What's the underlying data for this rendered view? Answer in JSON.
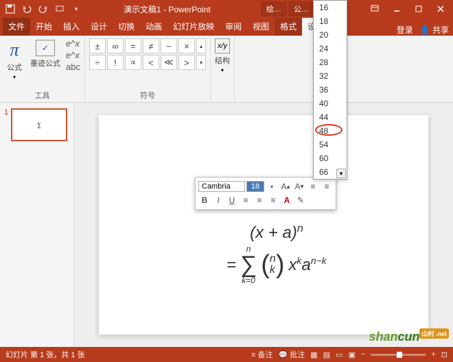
{
  "app": {
    "title": "演示文稿1 - PowerPoint"
  },
  "context_tabs": [
    "绘…",
    "公…"
  ],
  "menu": {
    "file": "文件",
    "home": "开始",
    "insert": "插入",
    "design": "设计",
    "transition": "切换",
    "animation": "动画",
    "slideshow": "幻灯片放映",
    "review": "审阅",
    "view": "视图",
    "format": "格式",
    "design2": "设计",
    "login": "登录",
    "share": "共享"
  },
  "ribbon": {
    "tools_label": "工具",
    "symbols_label": "符号",
    "struct_label": "结构",
    "formula": "公式",
    "ink": "墨迹公式",
    "small_col": [
      "e^x",
      "e^x",
      "abc"
    ],
    "sym_row1": [
      "±",
      "∞",
      "=",
      "≠",
      "~",
      "×"
    ],
    "sym_row2": [
      "÷",
      "!",
      "∝",
      "<",
      "≪",
      ">"
    ],
    "struct_icon": "x/y"
  },
  "thumb": {
    "num": "1"
  },
  "mini_toolbar": {
    "font": "Cambria",
    "size": "18"
  },
  "size_dropdown": [
    "16",
    "18",
    "20",
    "24",
    "28",
    "32",
    "36",
    "40",
    "44",
    "48",
    "54",
    "60",
    "66"
  ],
  "size_highlight": "48",
  "statusbar": {
    "left": "幻灯片 第 1 张，共 1 张",
    "notes": "备注",
    "comments": "批注"
  },
  "chart_data": {
    "type": "equation",
    "latex": "(x+a)^{n} = \\sum_{k=0}^{n} \\binom{n}{k} x^{k} a^{n-k}",
    "display": {
      "line1": "(x + a)^n",
      "line2_prefix": "=",
      "sum_lower": "k=0",
      "sum_upper": "n",
      "binom_top": "n",
      "binom_bottom": "k",
      "tail": "x^k a^{n−k}"
    }
  },
  "watermark": {
    "t1": "shan",
    "t2": "cun",
    "badge": "山村\n.net"
  }
}
